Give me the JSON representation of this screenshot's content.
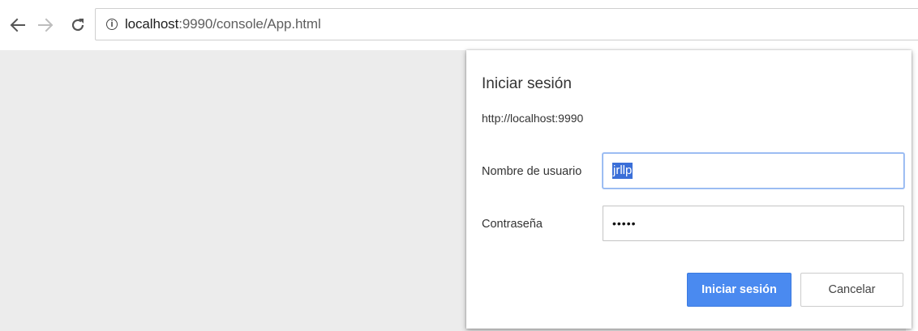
{
  "browser": {
    "url_host": "localhost",
    "url_rest": ":9990/console/App.html",
    "icons": {
      "back": "back-arrow-icon",
      "forward": "forward-arrow-icon",
      "reload": "reload-icon",
      "info": "info-icon"
    },
    "info_glyph": "i"
  },
  "dialog": {
    "title": "Iniciar sesión",
    "origin": "http://localhost:9990",
    "username_label": "Nombre de usuario",
    "username_value": "jrllp",
    "password_label": "Contraseña",
    "password_value": "•••••",
    "submit_label": "Iniciar sesión",
    "cancel_label": "Cancelar"
  },
  "colors": {
    "primary_button": "#4a8af0",
    "page_background": "#ececec",
    "selection": "#3b6fd8"
  }
}
